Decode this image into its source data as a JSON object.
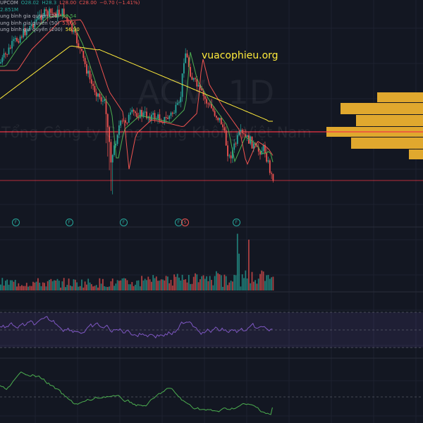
{
  "legend": {
    "symbol_line": [
      "UPCOM",
      "O28.02",
      "H28.3",
      "L28.00",
      "C28.00",
      "−0.70 (−1.41%)"
    ],
    "volume": "2.851M",
    "ma_rows": [
      {
        "label": "ung bình gia quyền (20)",
        "value": "52.54",
        "color": "#4caf50"
      },
      {
        "label": "ung bình gia quyền (50)",
        "value": "53.56",
        "color": "#ef5350"
      },
      {
        "label": "ung bình gia quyền (200)",
        "value": "56.90",
        "color": "#ffeb3b"
      }
    ]
  },
  "watermark": {
    "symbol": "ACV, 1D",
    "company": "Tổng Công ty Cảng Hàng Không Việt Nam"
  },
  "brand": "vuacophieu.org",
  "event_markers": [
    {
      "label": "F",
      "kind": "dividend"
    },
    {
      "label": "F",
      "kind": "dividend"
    },
    {
      "label": "F",
      "kind": "dividend"
    },
    {
      "label": "F",
      "kind": "dividend"
    },
    {
      "label": "S",
      "kind": "split"
    },
    {
      "label": "F",
      "kind": "dividend"
    }
  ],
  "colors": {
    "background": "#131722",
    "up": "#26a69a",
    "down": "#ef5350",
    "ma20": "#4caf50",
    "ma50": "#ef5350",
    "ma200": "#ffeb3b",
    "rsi": "#7e57c2",
    "osc": "#4caf50",
    "volume_profile": "#e0a82e",
    "level_line": "#f23645"
  }
}
